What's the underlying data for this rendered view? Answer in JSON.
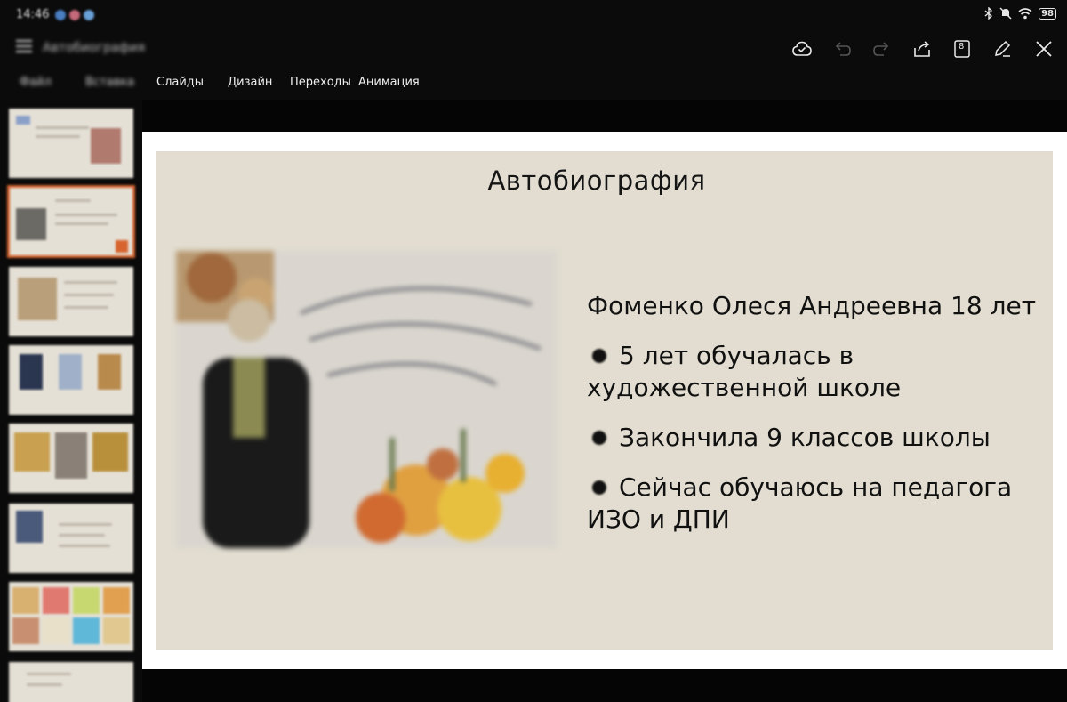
{
  "status_bar": {
    "time": "14:46",
    "battery": "98",
    "icons": [
      "bluetooth-icon",
      "mute-icon",
      "wifi-icon",
      "battery-icon"
    ]
  },
  "toolbar": {
    "document_title": "Автобиография",
    "buttons": [
      "cloud-save-icon",
      "undo-icon",
      "redo-icon",
      "share-icon",
      "slide-count-icon",
      "edit-pen-icon",
      "close-icon"
    ],
    "slide_count": "8"
  },
  "tabs": {
    "items": [
      {
        "label": "Файл",
        "blurred": true
      },
      {
        "label": "Вставка",
        "blurred": true
      },
      {
        "label": "Слайды",
        "blurred": true
      },
      {
        "label": "Дизайн",
        "blurred": false
      },
      {
        "label": "Переходы",
        "blurred": false
      },
      {
        "label": "Анимация",
        "blurred": false
      }
    ]
  },
  "thumbnails": {
    "count": 8,
    "active_index": 1
  },
  "slide": {
    "title": "Автобиография",
    "line1": "Фоменко Олеся Андреевна 18 лет",
    "bullet1_a": "5 лет обучалась в",
    "bullet1_b": "художественной школе",
    "bullet2": "Закончила 9 классов школы",
    "bullet3_a": "Сейчас обучаюсь на педагога",
    "bullet3_b": "ИЗО и ДПИ"
  },
  "colors": {
    "background": "#050505",
    "slide_bg": "#e2ddd0",
    "active_thumb": "#d7642e",
    "text": "#111111"
  }
}
